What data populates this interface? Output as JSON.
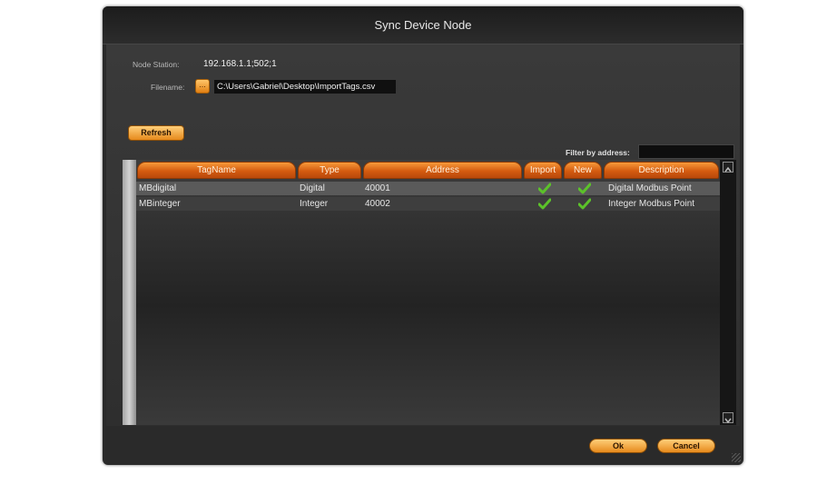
{
  "window": {
    "title": "Sync Device Node"
  },
  "node_station": {
    "label": "Node Station:",
    "value": "192.168.1.1;502;1"
  },
  "filename": {
    "label": "Filename:",
    "browse_label": "...",
    "value": "C:\\Users\\Gabriel\\Desktop\\ImportTags.csv"
  },
  "refresh_label": "Refresh",
  "filter": {
    "label": "Filter by address:",
    "value": ""
  },
  "table": {
    "columns": [
      "TagName",
      "Type",
      "Address",
      "Import",
      "New",
      "Description"
    ],
    "rows": [
      {
        "tagname": "MBdigital",
        "type": "Digital",
        "address": "40001",
        "import": true,
        "new": true,
        "description": "Digital Modbus Point"
      },
      {
        "tagname": "MBinteger",
        "type": "Integer",
        "address": "40002",
        "import": true,
        "new": true,
        "description": "Integer Modbus Point"
      }
    ]
  },
  "footer": {
    "ok_label": "Ok",
    "cancel_label": "Cancel"
  },
  "colors": {
    "accent": "#e8841c",
    "header": "#d45b10",
    "check": "#5cc22a",
    "panel": "#2e2e2e"
  },
  "icons": {
    "check": "check-icon",
    "browse": "ellipsis-icon",
    "scroll_up": "chevron-up-icon",
    "scroll_down": "chevron-down-icon",
    "resize": "resize-grip-icon"
  }
}
